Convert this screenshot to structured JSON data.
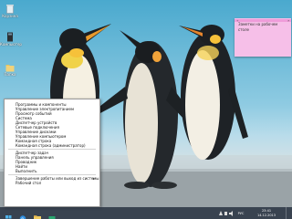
{
  "desktop": {
    "icons": [
      {
        "label": "Корзина",
        "icon": "recycle-bin-icon"
      },
      {
        "label": "Компьютер",
        "icon": "computer-icon"
      },
      {
        "label": "Папка",
        "icon": "folder-icon"
      }
    ]
  },
  "sticky_note": {
    "text": "Заметки на рабочем столе"
  },
  "context_menu": {
    "items": [
      "Программы и компоненты",
      "Управление электропитанием",
      "Просмотр событий",
      "Система",
      "Диспетчер устройств",
      "Сетевые подключения",
      "Управление дисками",
      "Управление компьютером",
      "Командная строка",
      "Командная строка (администратор)",
      "Диспетчер задач",
      "Панель управления",
      "Проводник",
      "Найти",
      "Выполнить",
      "Завершение работы или выход из системы",
      "Рабочий стол"
    ]
  },
  "taskbar": {
    "items": [
      "start-icon",
      "ie-icon",
      "explorer-icon",
      "store-icon"
    ],
    "tray": {
      "lang": "РУС",
      "time": "23:41",
      "date": "14.12.2013"
    }
  },
  "colors": {
    "taskbar": "#1e2837",
    "note": "#f6bfe8",
    "menu_bg": "#ffffff"
  }
}
